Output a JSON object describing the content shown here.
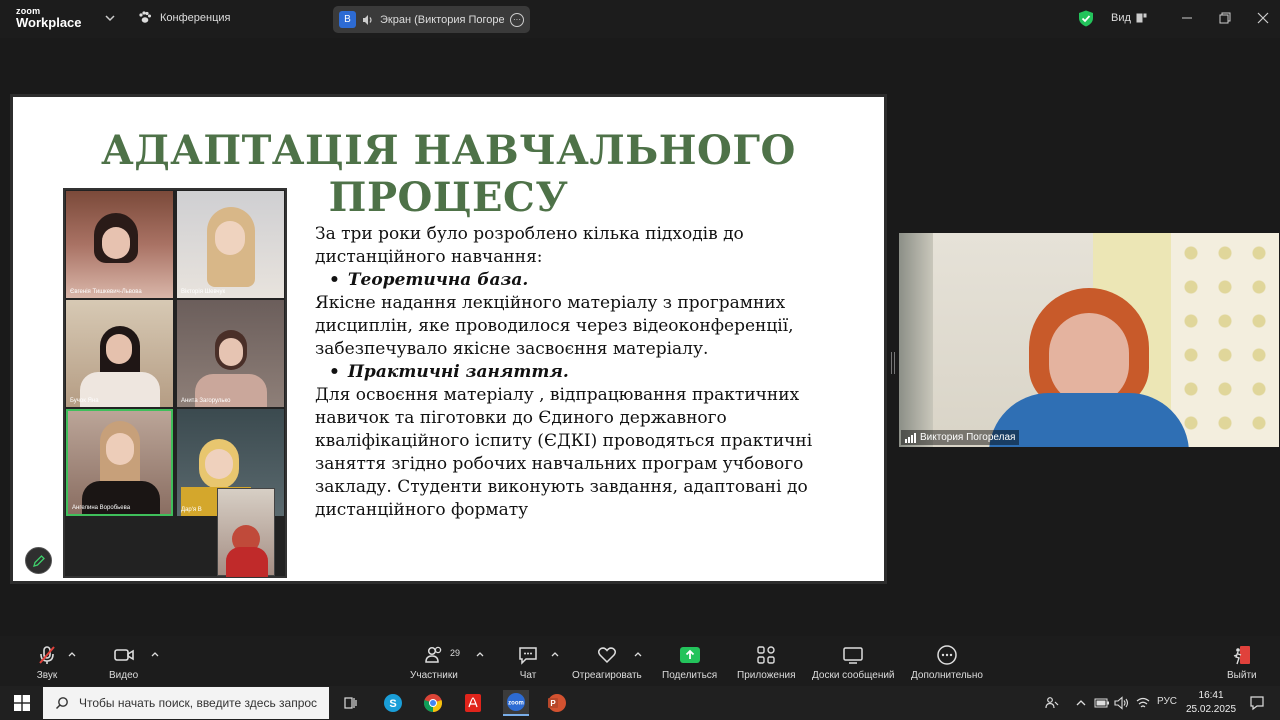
{
  "app": {
    "logo_small": "zoom",
    "logo_main": "Workplace",
    "conference_label": "Конференция"
  },
  "share": {
    "avatar_letter": "В",
    "label": "Экран (Виктория Погорела"
  },
  "top_right": {
    "view_label": "Вид"
  },
  "slide": {
    "title": "АДАПТАЦІЯ НАВЧАЛЬНОГО ПРОЦЕСУ",
    "paragraphs": [
      {
        "type": "text",
        "text": "За три роки було розроблено кілька підходів до дистанційного навчання:"
      },
      {
        "type": "bullet",
        "text": "Теоретична база."
      },
      {
        "type": "text",
        "text": "Якісне надання лекційного матеріалу з програмних дисциплін, яке проводилося через відеоконференції, забезпечувало якісне засвоєння матеріалу."
      },
      {
        "type": "bullet",
        "text": "Практичні заняття."
      },
      {
        "type": "text",
        "text": "Для освоєння матеріалу , відпрацювання практичних навичок та пiготовки до Єдиного державного кваліфікаційного іспиту (ЄДКІ) проводяться практичні заняття  згідно робочих навчальних програм учбового закладу. Студенти виконують завдання, адаптовані до дистанційного формату"
      }
    ],
    "collage_names": [
      "Євгенія Тишкевич-Львова",
      "Вікторія Шевчук",
      "Бучок Яна",
      "Анита Загорулько",
      "Ангелина Воробьева",
      "Дар'я В"
    ]
  },
  "speaker": {
    "name": "Виктория Погорелая"
  },
  "toolbar": {
    "audio": "Звук",
    "video": "Видео",
    "participants": "Участники",
    "participants_count": "29",
    "chat": "Чат",
    "react": "Отреагировать",
    "share": "Поделиться",
    "apps": "Приложения",
    "whiteboards": "Доски сообщений",
    "more": "Дополнительно",
    "leave": "Выйти"
  },
  "taskbar": {
    "search_placeholder": "Чтобы начать поиск, введите здесь запрос",
    "lang": "РУС",
    "time": "16:41",
    "date": "25.02.2025"
  },
  "colors": {
    "slide_title": "#4e7248",
    "share_green": "#23c35b",
    "leave_red": "#e0413b",
    "zoom_blue": "#2d6bd3"
  }
}
